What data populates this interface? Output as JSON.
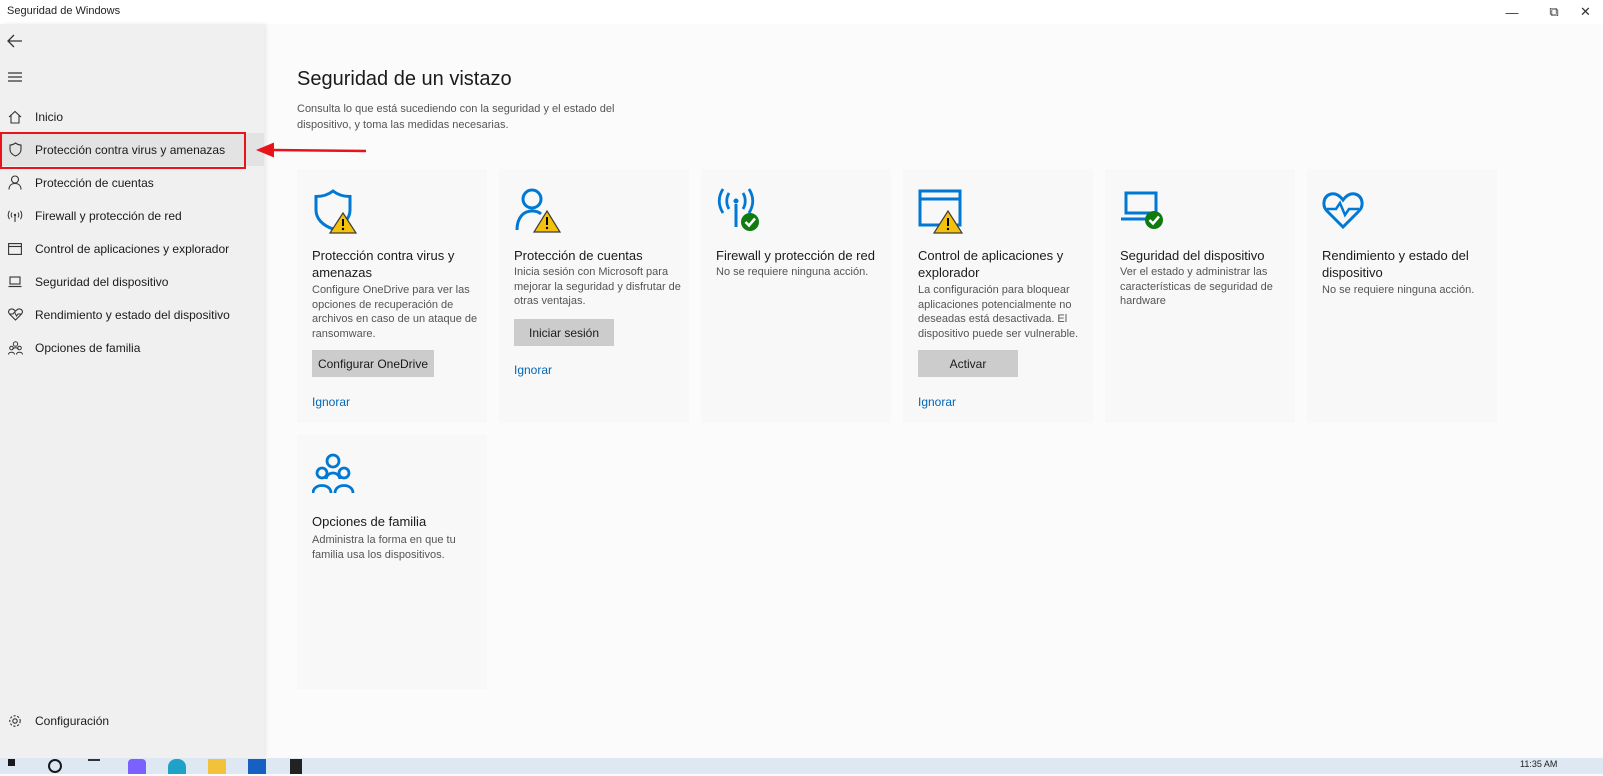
{
  "window": {
    "title": "Seguridad de Windows",
    "controls": {
      "minimize": "—",
      "restore": "⧉",
      "close": "✕"
    }
  },
  "sidebar": {
    "items": [
      {
        "label": "Inicio",
        "icon": "home-icon"
      },
      {
        "label": "Protección contra virus y amenazas",
        "icon": "shield-icon",
        "active": true
      },
      {
        "label": "Protección de cuentas",
        "icon": "person-icon"
      },
      {
        "label": "Firewall y protección de red",
        "icon": "wifi-antenna-icon"
      },
      {
        "label": "Control de aplicaciones y explorador",
        "icon": "browser-window-icon"
      },
      {
        "label": "Seguridad del dispositivo",
        "icon": "laptop-icon"
      },
      {
        "label": "Rendimiento y estado del dispositivo",
        "icon": "heart-icon"
      },
      {
        "label": "Opciones de familia",
        "icon": "family-icon"
      }
    ],
    "settings_label": "Configuración"
  },
  "main": {
    "title": "Seguridad de un vistazo",
    "description": "Consulta lo que está sucediendo con la seguridad y el estado del dispositivo, y toma las medidas necesarias."
  },
  "cards": [
    {
      "title": "Protección contra virus y amenazas",
      "description": "Configure OneDrive para ver las opciones de recuperación de archivos en caso de un ataque de ransomware.",
      "button": "Configurar OneDrive",
      "link": "Ignorar",
      "status": "warning"
    },
    {
      "title": "Protección de cuentas",
      "description": "Inicia sesión con Microsoft para mejorar la seguridad y disfrutar de otras ventajas.",
      "button": "Iniciar sesión",
      "link": "Ignorar",
      "status": "warning"
    },
    {
      "title": "Firewall y protección de red",
      "description": "No se requiere ninguna acción.",
      "status": "ok"
    },
    {
      "title": "Control de aplicaciones y explorador",
      "description": "La configuración para bloquear aplicaciones potencialmente no deseadas está desactivada. El dispositivo puede ser vulnerable.",
      "button": "Activar",
      "link": "Ignorar",
      "status": "warning"
    },
    {
      "title": "Seguridad del dispositivo",
      "description": "Ver el estado y administrar las características de seguridad de hardware",
      "status": "ok"
    },
    {
      "title": "Rendimiento y estado del dispositivo",
      "description": "No se requiere ninguna acción.",
      "status": "ok"
    },
    {
      "title": "Opciones de familia",
      "description": "Administra la forma en que tu familia usa los dispositivos."
    }
  ],
  "taskbar": {
    "time": "11:35 AM"
  },
  "colors": {
    "accent": "#0067b8",
    "icon_blue": "#0078d4",
    "warning": "#f4c20d",
    "ok": "#107c10",
    "annotation": "#e8131b"
  }
}
